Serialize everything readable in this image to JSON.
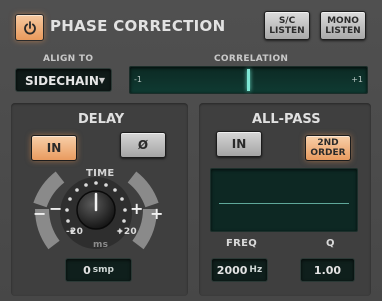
{
  "header": {
    "title": "PHASE CORRECTION",
    "sc_listen": [
      "S/C",
      "LISTEN"
    ],
    "mono_listen": [
      "MONO",
      "LISTEN"
    ]
  },
  "align_to": {
    "label": "ALIGN TO",
    "value": "SIDECHAIN"
  },
  "correlation": {
    "label": "CORRELATION",
    "min_label": "-1",
    "max_label": "+1",
    "value": 0.0
  },
  "delay": {
    "title": "DELAY",
    "in_label": "IN",
    "polarity_label": "Ø",
    "time_label": "TIME",
    "minus": "−",
    "minus_far": "−",
    "plus": "+",
    "plus_far": "+",
    "range_min": "-20",
    "range_max": "+20",
    "unit_ms": "ms",
    "value": "0",
    "value_unit": "smp"
  },
  "allpass": {
    "title": "ALL-PASS",
    "in_label": "IN",
    "order_label": [
      "2ND",
      "ORDER"
    ],
    "freq_label": "FREQ",
    "freq_value": "2000",
    "freq_unit": "Hz",
    "q_label": "Q",
    "q_value": "1.00"
  },
  "colors": {
    "accent_on": "#e99b5f",
    "meter_bg": "#0f3a32",
    "indicator": "#7fe8d6"
  }
}
